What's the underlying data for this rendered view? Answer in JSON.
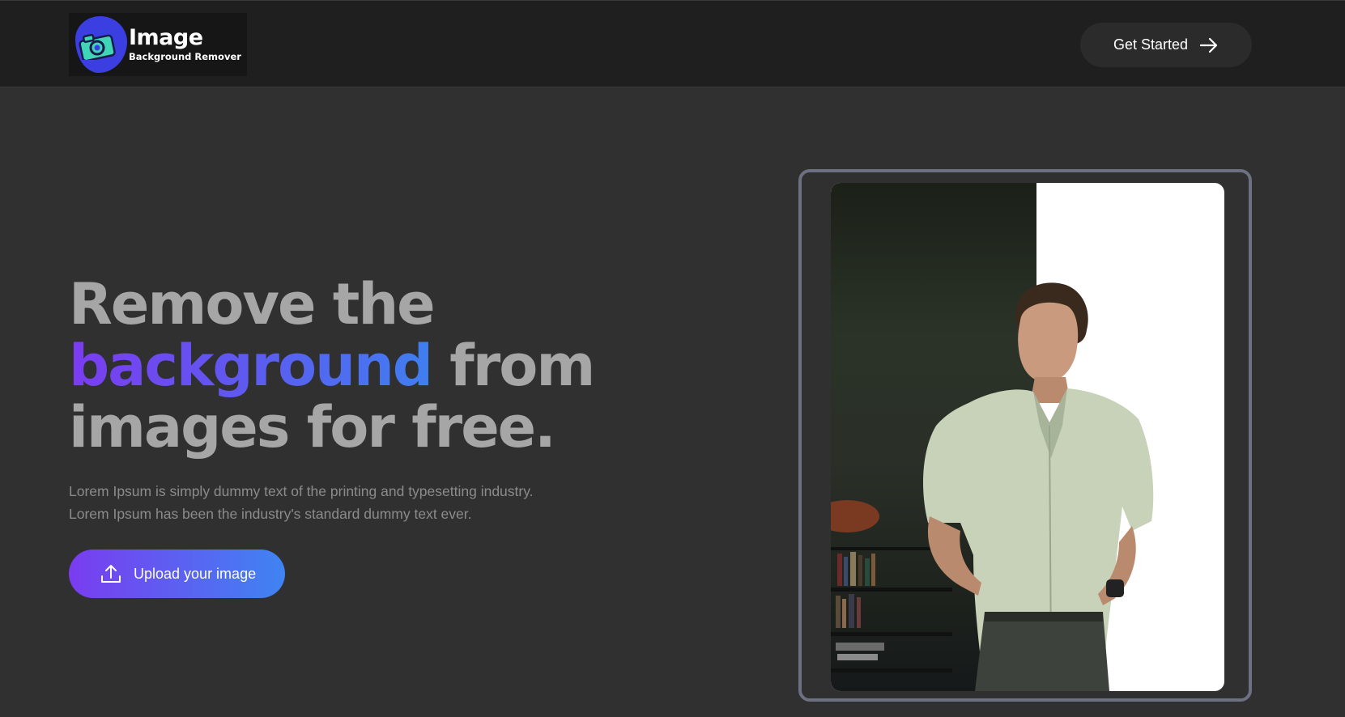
{
  "header": {
    "logo": {
      "title": "Image",
      "subtitle": "Background Remover",
      "icon": "camera-icon"
    },
    "cta": {
      "label": "Get Started",
      "icon": "arrow-right-icon"
    }
  },
  "hero": {
    "title_line1": "Remove the",
    "title_highlight": "background",
    "title_line2_rest": " from",
    "title_line3": "images for free.",
    "description_line1": "Lorem Ipsum is simply dummy text of the printing and typesetting industry.",
    "description_line2": "Lorem Ipsum has been the industry's standard dummy text ever.",
    "upload_button": {
      "label": "Upload your image",
      "icon": "upload-icon"
    }
  },
  "preview": {
    "image": "man-in-white-shirt-photo"
  },
  "colors": {
    "background": "#303030",
    "topbar": "#1f1f1f",
    "gradient_start": "#7a3cf0",
    "gradient_end": "#3f84f2",
    "title_gray": "#a6a6a6",
    "frame_border": "#6c7080",
    "logo_blob": "#3b3ee0",
    "logo_camera": "#3fd6b8"
  }
}
